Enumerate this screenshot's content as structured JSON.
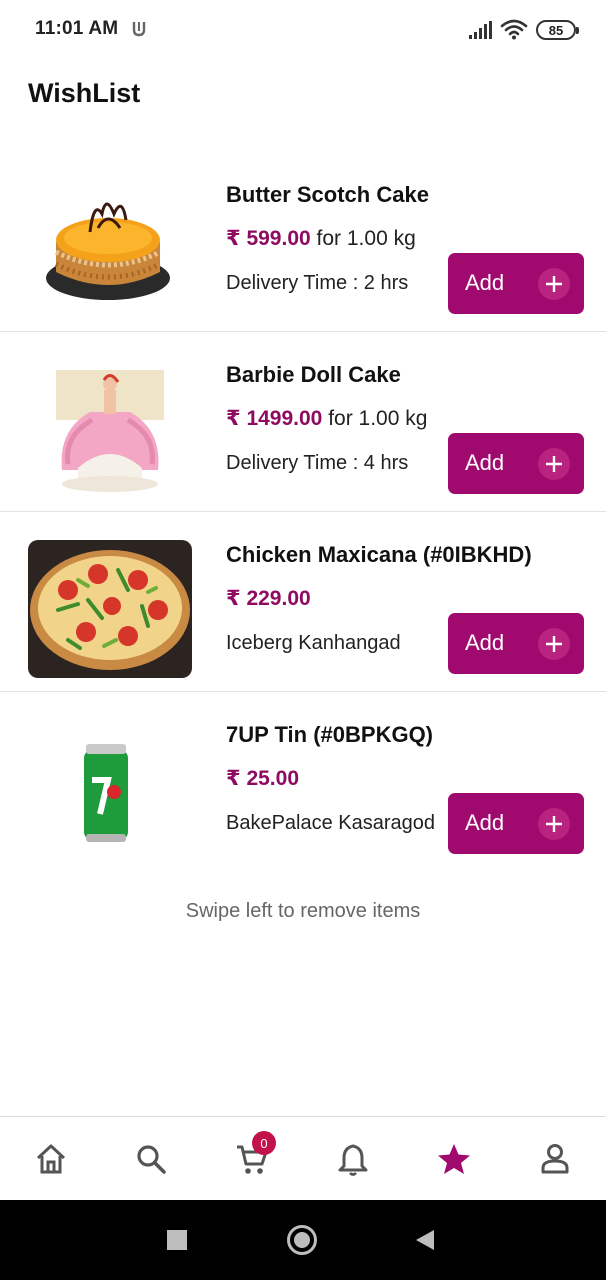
{
  "status_bar": {
    "time": "11:01 AM",
    "battery": "85"
  },
  "page": {
    "title": "WishList",
    "hint": "Swipe left to remove items"
  },
  "currency_symbol": "₹",
  "items": [
    {
      "name": "Butter Scotch Cake",
      "price": "₹ 599.00",
      "unit": "for 1.00 kg",
      "sub": "Delivery Time : 2 hrs",
      "add_label": "Add",
      "image": "butterscotch-cake"
    },
    {
      "name": "Barbie Doll Cake",
      "price": "₹ 1499.00",
      "unit": "for 1.00 kg",
      "sub": "Delivery Time : 4 hrs",
      "add_label": "Add",
      "image": "barbie-doll-cake"
    },
    {
      "name": "Chicken Maxicana (#0IBKHD)",
      "price": "₹ 229.00",
      "unit": "",
      "sub": "Iceberg Kanhangad",
      "add_label": "Add",
      "image": "pizza"
    },
    {
      "name": "7UP Tin (#0BPKGQ)",
      "price": "₹ 25.00",
      "unit": "",
      "sub": "BakePalace Kasaragod",
      "add_label": "Add",
      "image": "7up-can"
    }
  ],
  "bottom_nav": {
    "cart_count": "0",
    "items": [
      "home-icon",
      "search-icon",
      "cart-icon",
      "bell-icon",
      "star-icon",
      "profile-icon"
    ],
    "active": "star-icon"
  },
  "colors": {
    "accent": "#a00a6e",
    "price": "#8e0b61",
    "badge": "#c2124a",
    "nav_icon": "#555555"
  }
}
